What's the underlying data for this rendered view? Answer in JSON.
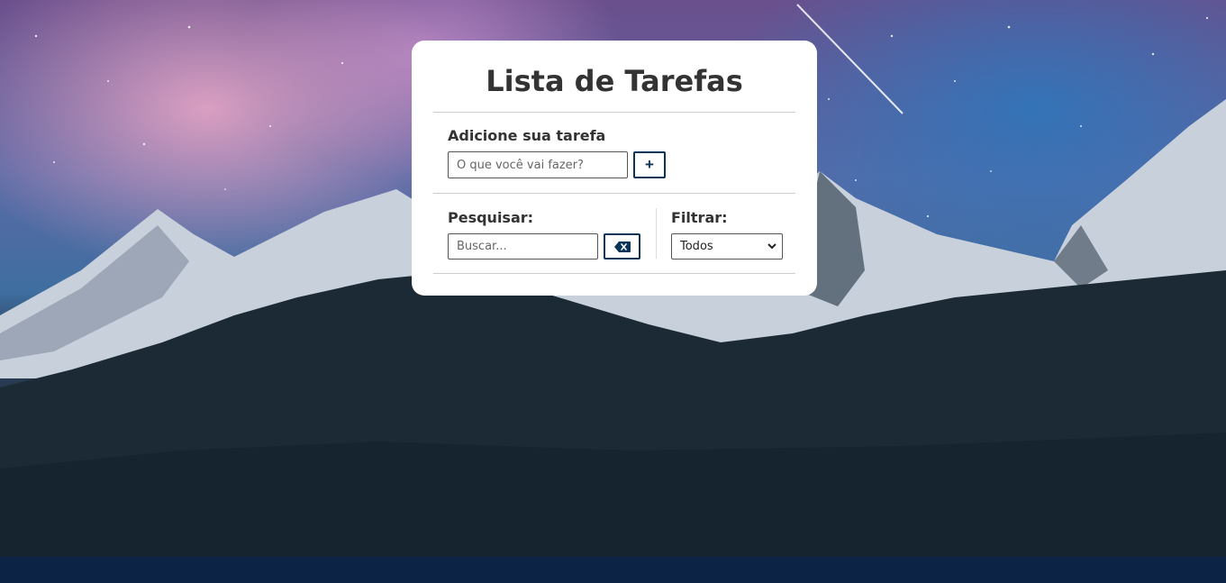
{
  "app": {
    "title": "Lista de Tarefas"
  },
  "add_section": {
    "label": "Adicione sua tarefa",
    "input_placeholder": "O que você vai fazer?",
    "input_value": "",
    "add_button_label": "+"
  },
  "search_section": {
    "label": "Pesquisar:",
    "input_placeholder": "Buscar...",
    "input_value": "",
    "clear_icon": "backspace-icon"
  },
  "filter_section": {
    "label": "Filtrar:",
    "selected": "Todos"
  },
  "colors": {
    "accent": "#0b3558",
    "card_bg": "#ffffff",
    "text": "#333333"
  }
}
